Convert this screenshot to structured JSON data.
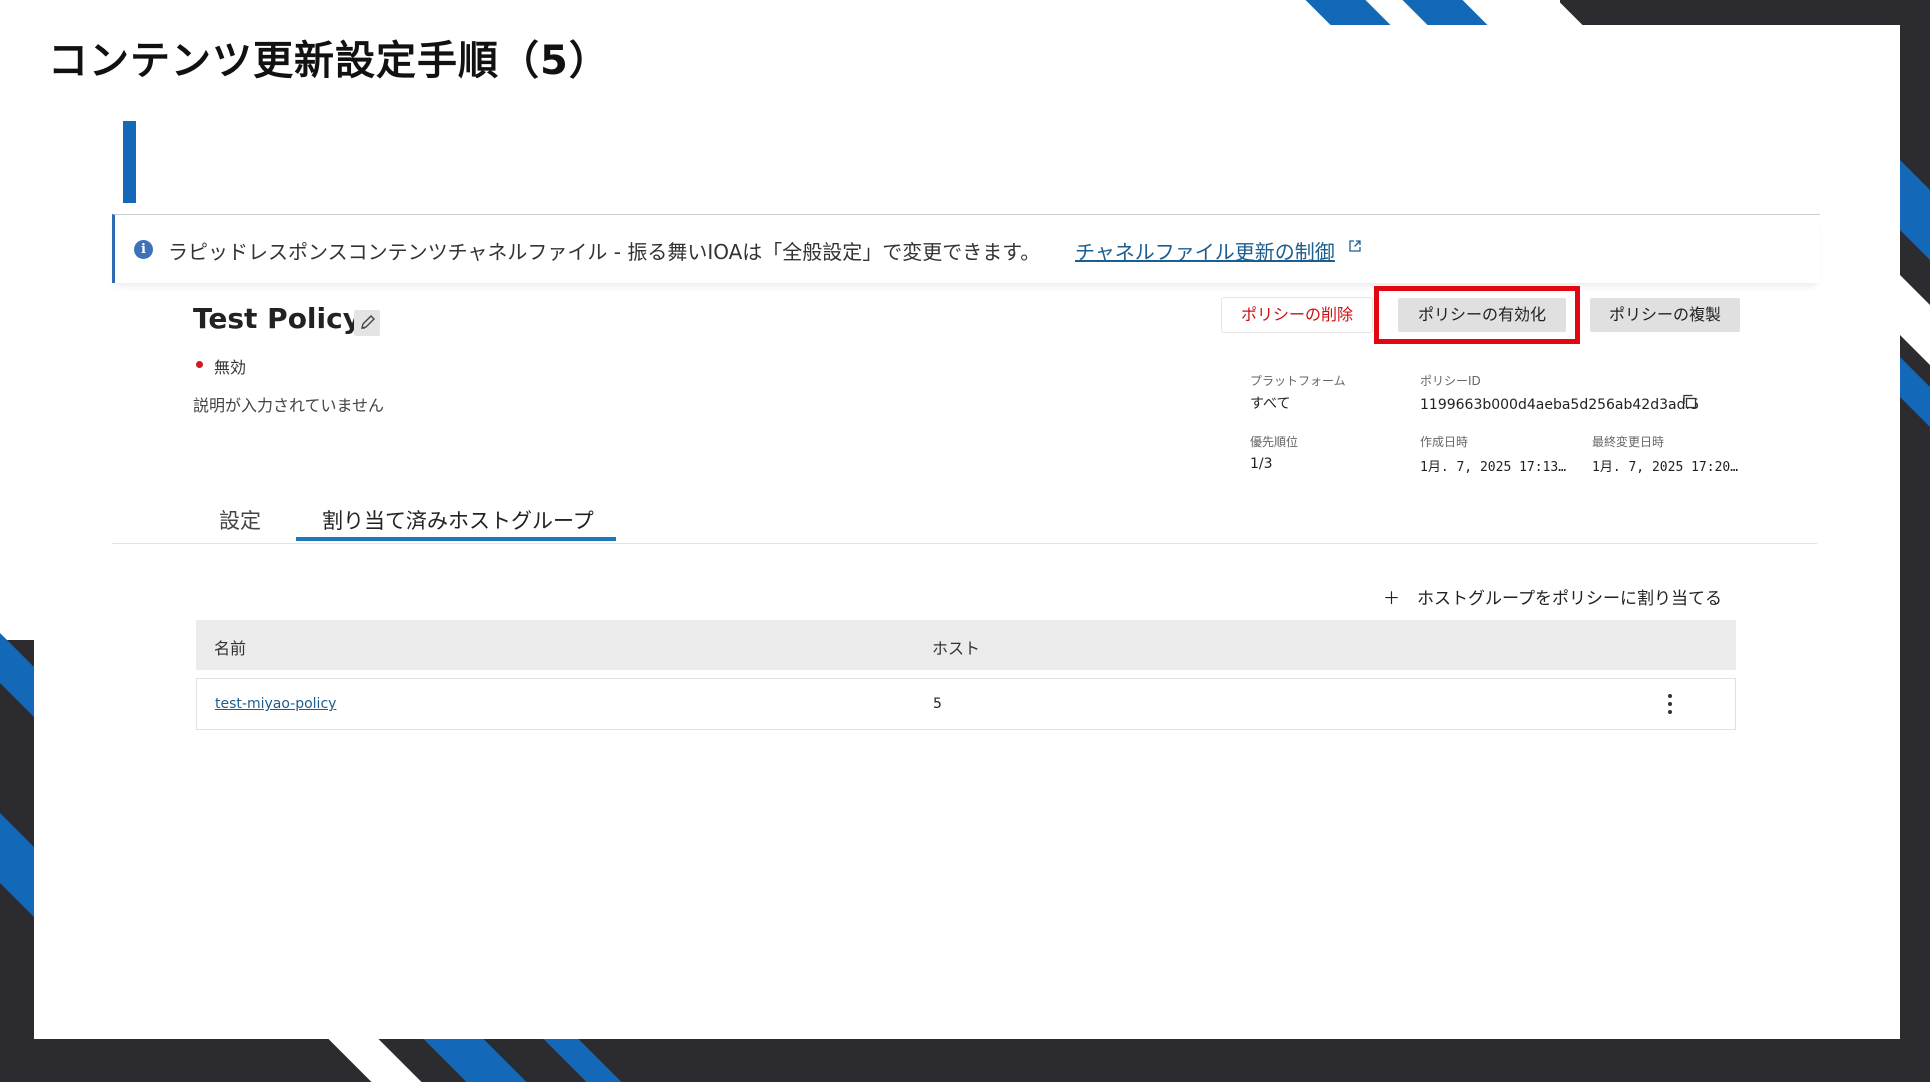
{
  "slide": {
    "title": "コンテンツ更新設定手順（5）"
  },
  "banner": {
    "text": "ラピッドレスポンスコンテンツチャネルファイル - 振る舞いIOAは「全般設定」で変更できます。",
    "link_label": "チャネルファイル更新の制御",
    "icons": [
      "info-icon",
      "external-link-icon"
    ]
  },
  "policy": {
    "name": "Test Policy",
    "status": "無効",
    "status_color": "#d11a1a",
    "description": "説明が入力されていません"
  },
  "actions": {
    "delete_label": "ポリシーの削除",
    "enable_label": "ポリシーの有効化",
    "duplicate_label": "ポリシーの複製",
    "highlight_color": "#e20613"
  },
  "meta": {
    "platform_label": "プラットフォーム",
    "platform_value": "すべて",
    "policy_id_label": "ポリシーID",
    "policy_id_value": "1199663b000d4aeba5d256ab42d3adf5",
    "priority_label": "優先順位",
    "priority_value": "1/3",
    "created_label": "作成日時",
    "created_value": "1月. 7, 2025 17:13…",
    "modified_label": "最終変更日時",
    "modified_value": "1月. 7, 2025 17:20…"
  },
  "tabs": [
    {
      "label": "設定",
      "active": false
    },
    {
      "label": "割り当て済みホストグループ",
      "active": true
    }
  ],
  "assign": {
    "label": "＋　ホストグループをポリシーに割り当てる"
  },
  "table": {
    "columns": [
      "名前",
      "ホスト"
    ],
    "rows": [
      {
        "name": "test-miyao-policy",
        "hosts": "5"
      }
    ]
  },
  "colors": {
    "accent": "#1468b8",
    "link": "#1b5e8f",
    "tab_active": "#1d78b8"
  }
}
